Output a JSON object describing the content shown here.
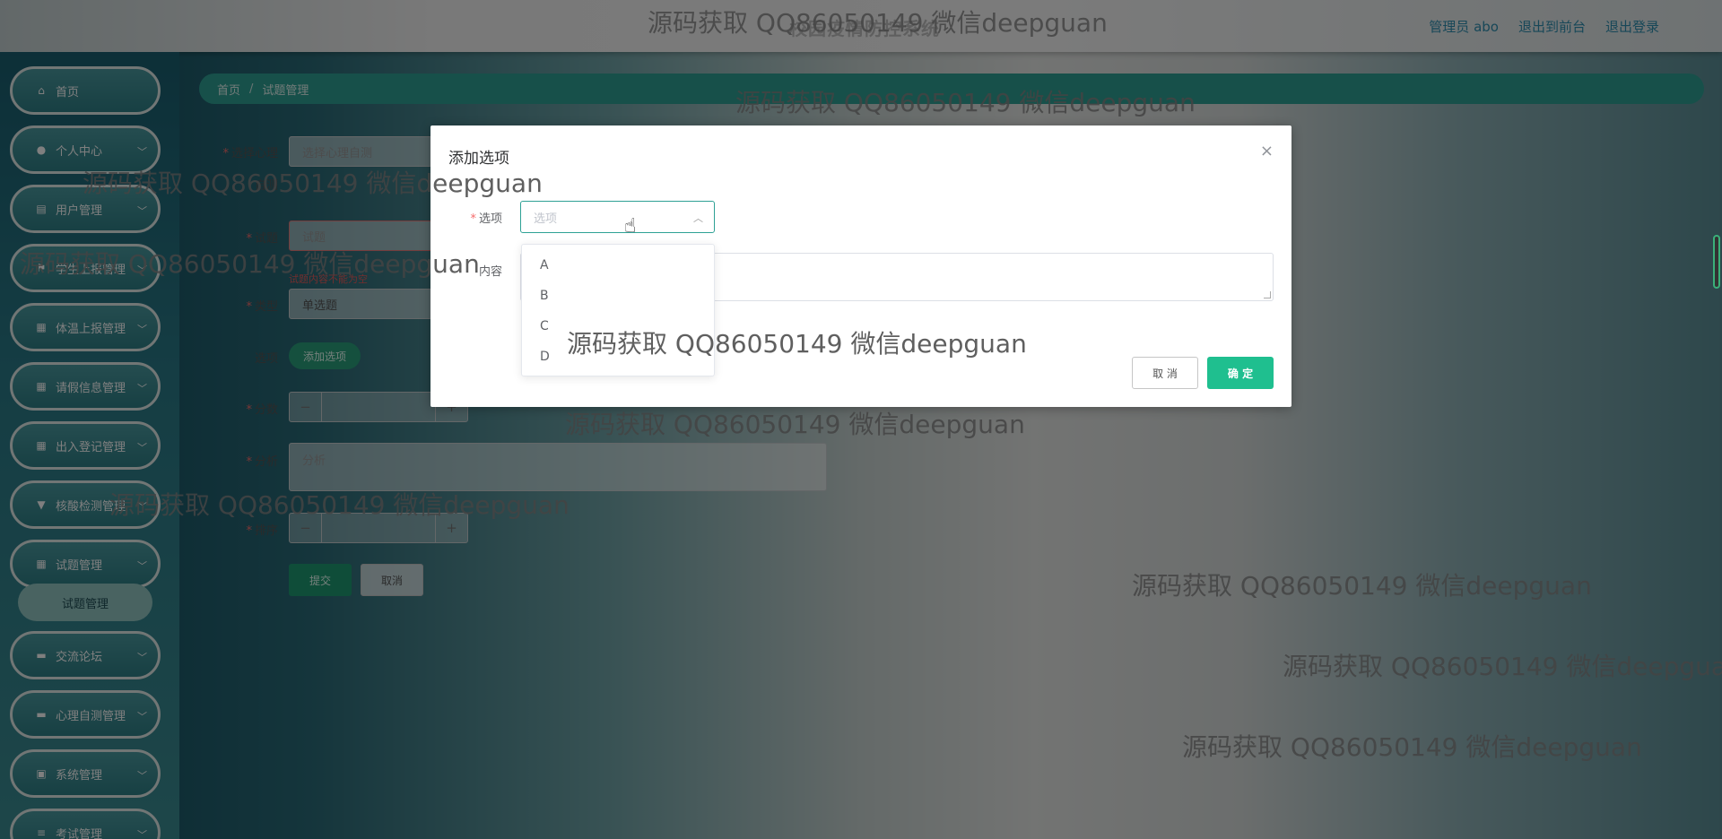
{
  "header": {
    "title": "校园疫情防控系统",
    "user": "管理员 abo",
    "to_front": "退出到前台",
    "logout": "退出登录"
  },
  "sidebar": {
    "items": [
      {
        "label": "首页",
        "icon": "home-icon"
      },
      {
        "label": "个人中心",
        "icon": "user-icon"
      },
      {
        "label": "用户管理",
        "icon": "doc-icon"
      },
      {
        "label": "学生上报管理",
        "icon": "flag-icon"
      },
      {
        "label": "体温上报管理",
        "icon": "grid-icon"
      },
      {
        "label": "请假信息管理",
        "icon": "grid-icon"
      },
      {
        "label": "出入登记管理",
        "icon": "grid-icon"
      },
      {
        "label": "核酸检测管理",
        "icon": "cup-icon"
      },
      {
        "label": "试题管理",
        "icon": "grid-icon"
      },
      {
        "label": "交流论坛",
        "icon": "chat-icon"
      },
      {
        "label": "心理自测管理",
        "icon": "chat-icon"
      },
      {
        "label": "系统管理",
        "icon": "box-icon"
      },
      {
        "label": "考试管理",
        "icon": "list-icon"
      }
    ],
    "sub_active": "试题管理"
  },
  "breadcrumb": {
    "home": "首页",
    "sep": "/",
    "current": "试题管理"
  },
  "form": {
    "psych_label": "选择心理",
    "psych_placeholder": "选择心理自测",
    "title_label": "自测",
    "question_label": "试题",
    "question_placeholder": "试题",
    "question_error": "试题内容不能为空",
    "type_label": "类型",
    "type_value": "单选题",
    "options_label": "选项",
    "add_option": "添加选项",
    "score_label": "分数",
    "analysis_label": "分析",
    "analysis_placeholder": "分析",
    "order_label": "排序",
    "submit": "提交",
    "cancel": "取消",
    "minus": "−",
    "plus": "+"
  },
  "dialog": {
    "title": "添加选项",
    "close": "×",
    "option_label": "选项",
    "option_placeholder": "选项",
    "content_label": "内容",
    "cancel": "取 消",
    "confirm": "确 定",
    "dropdown_options": [
      "A",
      "B",
      "C",
      "D"
    ]
  },
  "watermark": "源码获取 QQ86050149 微信deepguan",
  "colors": {
    "accent": "#2ea195",
    "primary_button": "#1fbf8f",
    "error": "#f56c6c"
  }
}
